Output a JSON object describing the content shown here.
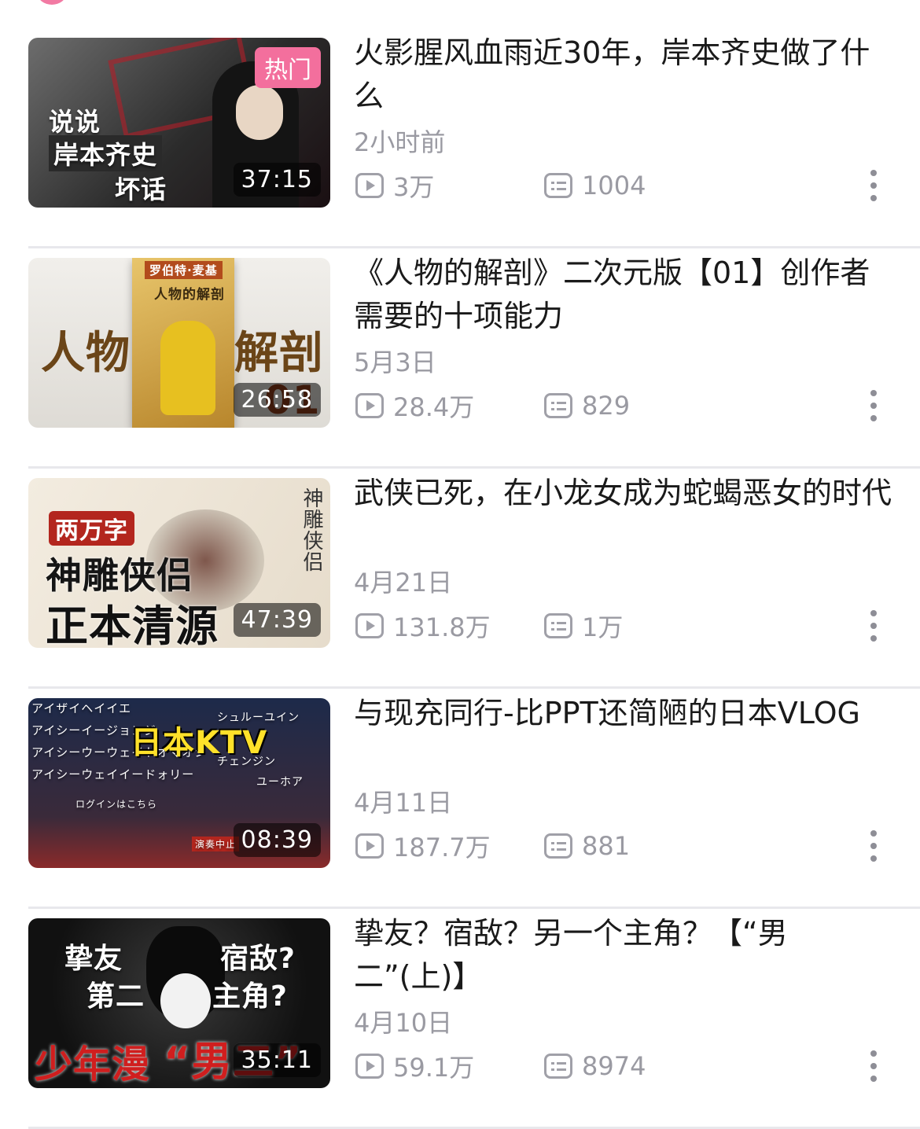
{
  "videos": [
    {
      "title": "火影腥风血雨近30年，岸本齐史做了什么",
      "date": "2小时前",
      "views": "3万",
      "comments": "1004",
      "duration": "37:15",
      "badge": "热门",
      "thumb_caption": [
        "说说",
        "岸本齐史",
        "坏话"
      ]
    },
    {
      "title": "《人物的解剖》二次元版【01】创作者需要的十项能力",
      "date": "5月3日",
      "views": "28.4万",
      "comments": "829",
      "duration": "26:58",
      "thumb_caption": [
        "人物",
        "解剖",
        "罗伯特·麦基",
        "人物的解剖",
        "01"
      ]
    },
    {
      "title": "武侠已死，在小龙女成为蛇蝎恶女的时代",
      "date": "4月21日",
      "views": "131.8万",
      "comments": "1万",
      "duration": "47:39",
      "thumb_caption": [
        "两万字",
        "神雕侠侣",
        "正本清源",
        "神雕侠侣"
      ]
    },
    {
      "title": "与现充同行-比PPT还简陋的日本VLOG",
      "date": "4月11日",
      "views": "187.7万",
      "comments": "881",
      "duration": "08:39",
      "thumb_caption": [
        "日本KTV",
        "アイザイヘイイエ",
        "アイシーイージョンジ",
        "アイシーウーウェイトオマオシ",
        "アイシーウェイイードォリー",
        "シュルーユイン",
        "チェンジン",
        "ユーホア",
        "ログインはこちら",
        "演奏中止"
      ]
    },
    {
      "title": "挚友？宿敌？另一个主角？【“男二”(上)】",
      "date": "4月10日",
      "views": "59.1万",
      "comments": "8974",
      "duration": "35:11",
      "thumb_caption": [
        "挚友",
        "宿敌?",
        "第二",
        "主角?",
        "少年漫",
        "“男二”"
      ]
    }
  ],
  "colors": {
    "accent": "#f36f9d",
    "meta": "#9a9aa2",
    "divider": "#e8e8ec"
  }
}
